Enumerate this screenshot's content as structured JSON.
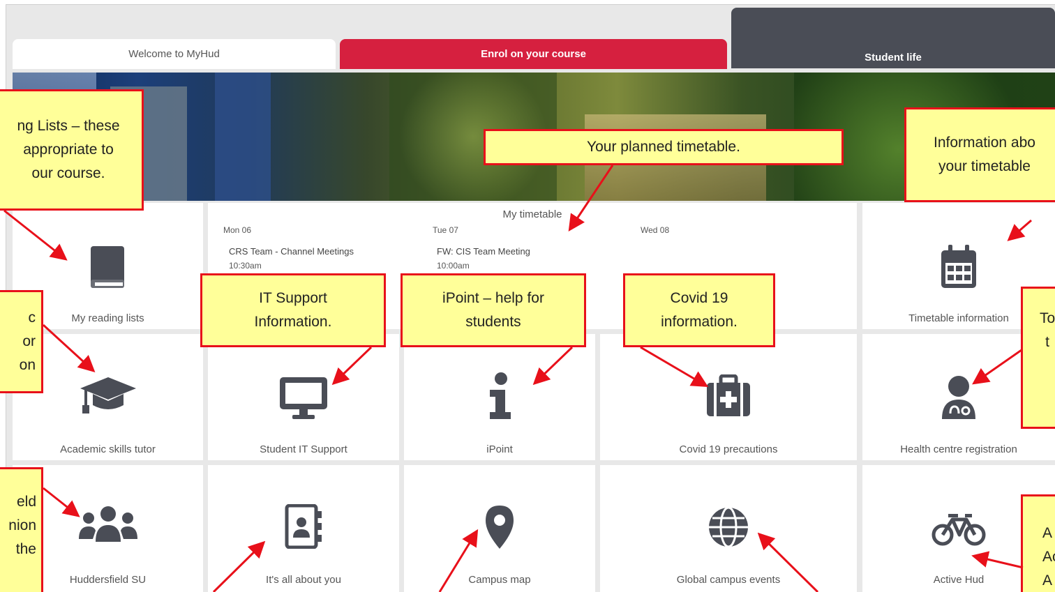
{
  "tabs": {
    "welcome": "Welcome to MyHud",
    "enrol": "Enrol on your course",
    "student_life": "Student life"
  },
  "tiles": {
    "reading_lists": "My reading lists",
    "timetable_info": "Timetable information",
    "academic_skills": "Academic skills tutor",
    "it_support": "Student IT Support",
    "ipoint": "iPoint",
    "covid": "Covid 19 precautions",
    "health_centre": "Health centre registration",
    "su": "Huddersfield SU",
    "about_you": "It's all about you",
    "campus_map": "Campus map",
    "global_events": "Global campus events",
    "active_hud": "Active Hud"
  },
  "timetable": {
    "title": "My timetable",
    "days": [
      {
        "label": "Mon 06",
        "event": "CRS Team - Channel Meetings",
        "time": "10:30am"
      },
      {
        "label": "Tue 07",
        "event": "FW: CIS Team Meeting",
        "time": "10:00am"
      },
      {
        "label": "Wed 08",
        "event": "",
        "time": ""
      }
    ]
  },
  "callouts": {
    "reading": [
      "ng Lists – these",
      "appropriate to",
      "our course."
    ],
    "planned": [
      "Your planned timetable."
    ],
    "timetable_info": [
      "Information abo",
      "your timetable"
    ],
    "academic": [
      "c",
      "or",
      "on"
    ],
    "it_support": [
      "IT Support",
      "Information."
    ],
    "ipoint": [
      "iPoint – help for",
      "students"
    ],
    "covid": [
      "Covid 19",
      "information."
    ],
    "health": [
      "To",
      "t"
    ],
    "su": [
      "eld",
      "nion",
      "the"
    ],
    "active": [
      "A",
      "Ac",
      "A"
    ]
  },
  "icons": {
    "reading": "book-icon",
    "timetable": "calendar-icon",
    "academic": "graduation-cap-icon",
    "it": "monitor-icon",
    "ipoint": "info-icon",
    "covid": "medkit-icon",
    "health": "doctor-icon",
    "su": "users-icon",
    "about": "address-book-icon",
    "map": "map-marker-icon",
    "global": "globe-icon",
    "active": "bicycle-icon"
  },
  "colors": {
    "enrol_tab": "#d6203f",
    "student_life_tab": "#4a4d56",
    "callout_fill": "#ffff99",
    "callout_border": "#e8101a",
    "icon": "#4a4d56"
  }
}
